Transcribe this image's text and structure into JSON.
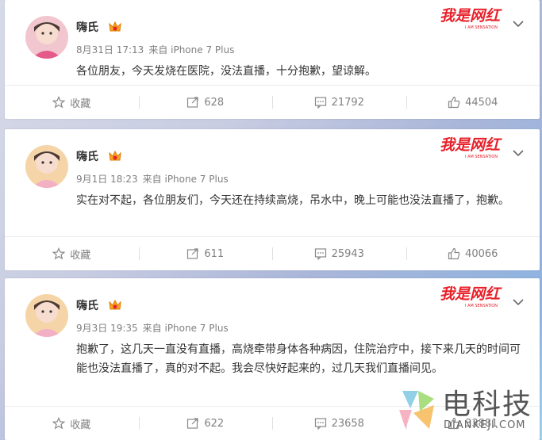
{
  "posts": [
    {
      "name": "嗨氏",
      "date": "8月31日 17:13",
      "source": "来自 iPhone 7 Plus",
      "text": "各位朋友，今天发烧在医院，没法直播，十分抱歉，望谅解。",
      "actions": {
        "fav": "收藏",
        "repost": "628",
        "comment": "21792",
        "like": "44504"
      }
    },
    {
      "name": "嗨氏",
      "date": "9月1日 18:23",
      "source": "来自 iPhone 7 Plus",
      "text": "实在对不起，各位朋友们，今天还在持续高烧，吊水中，晚上可能也没法直播了，抱歉。",
      "actions": {
        "fav": "收藏",
        "repost": "611",
        "comment": "25943",
        "like": "40066"
      }
    },
    {
      "name": "嗨氏",
      "date": "9月3日 19:35",
      "source": "来自 iPhone 7 Plus",
      "text": "抱歉了，这几天一直没有直播，高烧牵带身体各种病因，住院治疗中，接下来几天的时间可能也没法直播了，真的对不起。我会尽快好起来的，过几天我们直播间见。",
      "actions": {
        "fav": "收藏",
        "repost": "622",
        "comment": "23658",
        "like": "33881"
      }
    }
  ],
  "watermark": {
    "text": "我是网红",
    "sub": "I AM SENSATION"
  },
  "logo": {
    "cn": "电科技",
    "en": "DIANKEJI.COM"
  },
  "icons": [
    "star-icon",
    "repost-icon",
    "comment-icon",
    "thumbs-up-icon",
    "chevron-down-icon",
    "vip-badge-icon"
  ],
  "colors": {
    "watermark_red": "#e8202a",
    "text": "#333333",
    "meta": "#808080"
  }
}
